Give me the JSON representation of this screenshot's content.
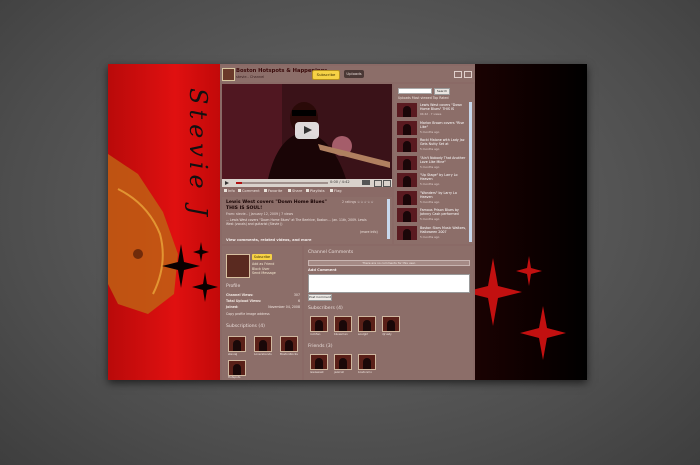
{
  "colors": {
    "accent_red": "#e01010",
    "panel": "#8c6e69",
    "subscribe_yellow": "#f6d245"
  },
  "background_text": {
    "signature": "Stevie J"
  },
  "header": {
    "channel_title": "Boston Hotspots & Happenings",
    "channel_sub": "stevie.. Channel",
    "subscribe_label": "Subscribe",
    "uploads_label": "Uploads"
  },
  "player": {
    "time": "0:00 / 4:42",
    "actions": [
      "Info",
      "Comment",
      "Favorite",
      "Share",
      "Playlists",
      "Flag"
    ],
    "video_title": "Lewis West covers \"Down Home Blues\" THIS IS SOUL!",
    "rating_text": "2 ratings",
    "meta": "From: stevie.. | January 12, 2009 | 7 views",
    "description": "... Lewis West covers \"Down Home Blues\" at The Beehive, Boston ... Jan. 11th, 2009. Lewis West (vocals) and guitarist (Stevie J)",
    "more_label": "(more info)",
    "bottom_links": "View comments, related videos, and more"
  },
  "sidebar": {
    "search_button": "Search",
    "tabs": "Uploads  Most viewed  Top Rated",
    "videos": [
      {
        "title": "Lewis West covers \"Down Home Blues\" THIS IS",
        "meta": "04:42 · 7 views"
      },
      {
        "title": "Marlon Brown covers \"Rise Like\"",
        "meta": "5 months ago"
      },
      {
        "title": "Rocki Malone with Lady Jaz Gets Nutty Set at",
        "meta": "5 months ago"
      },
      {
        "title": "\"Ain't Nobody That Another Love Like Mine\"",
        "meta": "5 months ago"
      },
      {
        "title": "\"Up Stage\" by Larry Lo Heaven",
        "meta": "5 months ago"
      },
      {
        "title": "\"Wonders\" by Larry Lo Heaven",
        "meta": "5 months ago"
      },
      {
        "title": "Famous Prison Blues by Johnny Cash performed",
        "meta": "5 months ago"
      },
      {
        "title": "Boston Stars Music Waltzes, Halloween 2007",
        "meta": "5 months ago"
      }
    ]
  },
  "profile": {
    "subscribe_label": "Subscribe",
    "links": [
      "Add as Friend",
      "Block User",
      "Send Message"
    ],
    "profile_heading": "Profile",
    "rows": [
      {
        "label": "Channel Views:",
        "value": "307"
      },
      {
        "label": "Total Upload Views:",
        "value": "6"
      },
      {
        "label": "Joined:",
        "value": "November 04, 2008"
      }
    ],
    "copy_link": "Copy  profile image address",
    "subscriptions_heading": "Subscriptions (4)",
    "subscriptions": [
      "stevieJ",
      "Loversbands",
      "BostonRocks",
      "Hotspots"
    ]
  },
  "comments": {
    "heading": "Channel Comments",
    "no_comments": "There are no comments for this user.",
    "add_label": "Add Comment",
    "post_label": "Post Comment",
    "subscribers_heading": "Subscribers (4)",
    "subscribers": [
      "rockfan",
      "bluesman",
      "soulgirl",
      "djrusty"
    ],
    "friends_heading": "Friends (3)",
    "friends": [
      "lewiswest",
      "jazzcat",
      "bostonmo"
    ]
  }
}
